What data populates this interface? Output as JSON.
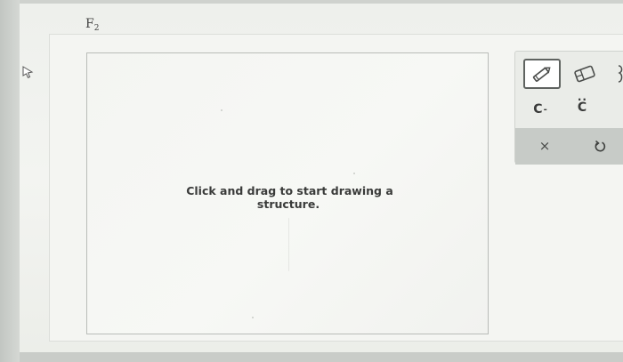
{
  "question": {
    "formula_base": "F",
    "formula_subscript": "2"
  },
  "canvas": {
    "hint_line_1": "Click and drag to start drawing a",
    "hint_line_2": "structure."
  },
  "toolbar": {
    "tools": [
      {
        "icon": "pencil-icon",
        "selected": true
      },
      {
        "icon": "eraser-icon",
        "selected": false
      }
    ],
    "carbon_anion": {
      "symbol": "C",
      "charge": "-"
    },
    "carbon_lone_pair": {
      "symbol": "C",
      "dots": ".."
    },
    "clear_symbol": "×",
    "undo_icon": "undo-icon"
  },
  "colors": {
    "panel_background": "#f3f4f1",
    "canvas_border": "#b9bcb8",
    "toolbar_background": "#eaece8",
    "toolbar_footer": "#c7cbc7",
    "selected_border": "#5f6360"
  }
}
